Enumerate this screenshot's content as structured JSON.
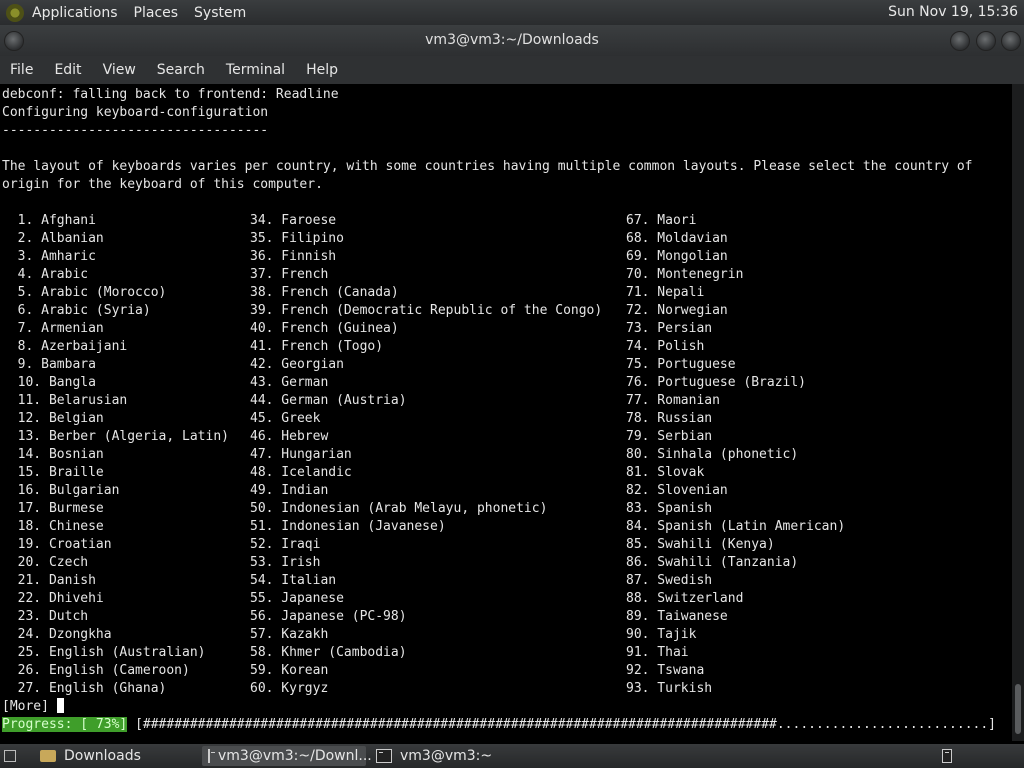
{
  "topbar": {
    "menus": [
      "Applications",
      "Places",
      "System"
    ],
    "clock": "Sun Nov 19, 15:36"
  },
  "window": {
    "title": "vm3@vm3:~/Downloads",
    "menus": [
      "File",
      "Edit",
      "View",
      "Search",
      "Terminal",
      "Help"
    ]
  },
  "terminal": {
    "header_lines": [
      "debconf: falling back to frontend: Readline",
      "Configuring keyboard-configuration",
      "----------------------------------",
      "",
      "The layout of keyboards varies per country, with some countries having multiple common layouts. Please select the country of",
      "origin for the keyboard of this computer."
    ],
    "col1": [
      "  1. Afghani",
      "  2. Albanian",
      "  3. Amharic",
      "  4. Arabic",
      "  5. Arabic (Morocco)",
      "  6. Arabic (Syria)",
      "  7. Armenian",
      "  8. Azerbaijani",
      "  9. Bambara",
      "  10. Bangla",
      "  11. Belarusian",
      "  12. Belgian",
      "  13. Berber (Algeria, Latin)",
      "  14. Bosnian",
      "  15. Braille",
      "  16. Bulgarian",
      "  17. Burmese",
      "  18. Chinese",
      "  19. Croatian",
      "  20. Czech",
      "  21. Danish",
      "  22. Dhivehi",
      "  23. Dutch",
      "  24. Dzongkha",
      "  25. English (Australian)",
      "  26. English (Cameroon)",
      "  27. English (Ghana)"
    ],
    "col2": [
      "34. Faroese",
      "35. Filipino",
      "36. Finnish",
      "37. French",
      "38. French (Canada)",
      "39. French (Democratic Republic of the Congo)",
      "40. French (Guinea)",
      "41. French (Togo)",
      "42. Georgian",
      "43. German",
      "44. German (Austria)",
      "45. Greek",
      "46. Hebrew",
      "47. Hungarian",
      "48. Icelandic",
      "49. Indian",
      "50. Indonesian (Arab Melayu, phonetic)",
      "51. Indonesian (Javanese)",
      "52. Iraqi",
      "53. Irish",
      "54. Italian",
      "55. Japanese",
      "56. Japanese (PC-98)",
      "57. Kazakh",
      "58. Khmer (Cambodia)",
      "59. Korean",
      "60. Kyrgyz"
    ],
    "col3": [
      "67. Maori",
      "68. Moldavian",
      "69. Mongolian",
      "70. Montenegrin",
      "71. Nepali",
      "72. Norwegian",
      "73. Persian",
      "74. Polish",
      "75. Portuguese",
      "76. Portuguese (Brazil)",
      "77. Romanian",
      "78. Russian",
      "79. Serbian",
      "80. Sinhala (phonetic)",
      "81. Slovak",
      "82. Slovenian",
      "83. Spanish",
      "84. Spanish (Latin American)",
      "85. Swahili (Kenya)",
      "86. Swahili (Tanzania)",
      "87. Swedish",
      "88. Switzerland",
      "89. Taiwanese",
      "90. Tajik",
      "91. Thai",
      "92. Tswana",
      "93. Turkish"
    ],
    "more_prompt": "[More]",
    "progress_label": "Progress: [ 73%]",
    "progress_bar": "[#################################################################################...........................]",
    "progress_percent": 73
  },
  "taskbar": {
    "items": [
      "Downloads",
      "vm3@vm3:~/Downl...",
      "vm3@vm3:~"
    ]
  },
  "colors": {
    "progress_green": "#3f9e2a",
    "terminal_bg": "#000000"
  }
}
